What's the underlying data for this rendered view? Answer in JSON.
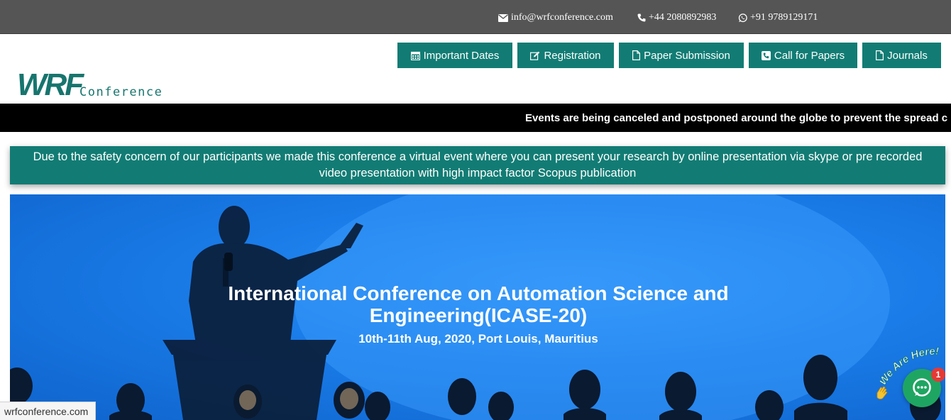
{
  "topbar": {
    "email": "info@wrfconference.com",
    "phone": "+44 2080892983",
    "whatsapp": "+91 9789129171"
  },
  "logo": {
    "mark": "WRF",
    "text": "Conference"
  },
  "nav": [
    {
      "label": "Important Dates",
      "icon": "calendar-icon"
    },
    {
      "label": "Registration",
      "icon": "edit-icon"
    },
    {
      "label": "Paper Submission",
      "icon": "file-icon"
    },
    {
      "label": "Call for Papers",
      "icon": "phone-square-icon"
    },
    {
      "label": "Journals",
      "icon": "file-icon"
    }
  ],
  "ticker": {
    "text": "Events are being canceled and postponed around the globe to prevent the spread c"
  },
  "notice": {
    "line1": "Due to the safety concern of our participants we made this conference a virtual event where you can present your research by online presentation via skype or pre recorded",
    "line2": "video presentation with high impact factor Scopus publication"
  },
  "hero": {
    "title_line1": "International Conference on Automation Science and",
    "title_line2": "Engineering(ICASE-20)",
    "subtitle": "10th-11th Aug, 2020, Port Louis, Mauritius"
  },
  "status_url": "wrfconference.com",
  "chat": {
    "label": "We Are Here!",
    "badge": "1"
  },
  "colors": {
    "brand": "#127c74",
    "topbar": "#555555",
    "hero_blue": "#1a7ce8",
    "chat_green": "#1fa562"
  }
}
